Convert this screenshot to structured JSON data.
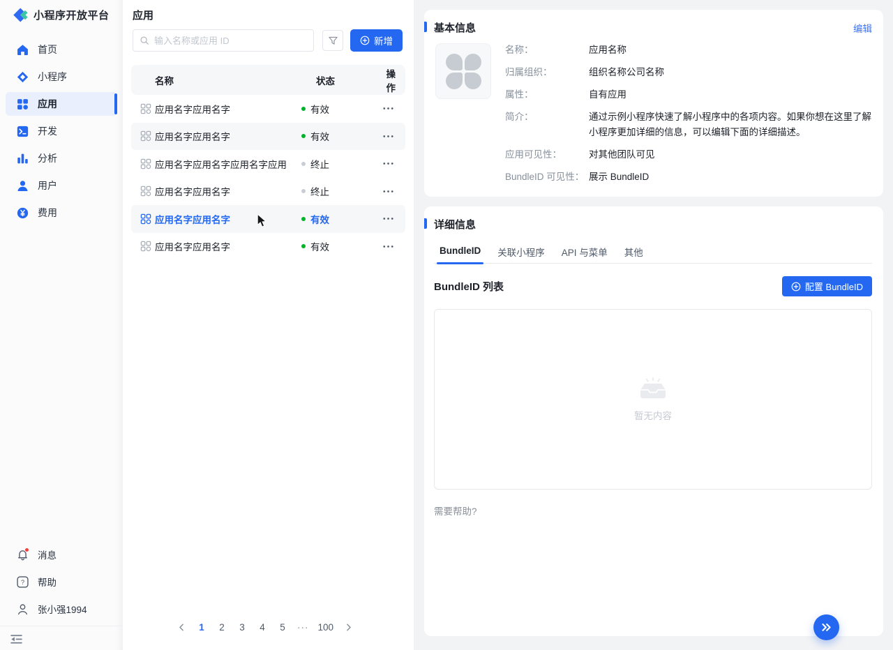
{
  "colors": {
    "primary": "#2468F2",
    "status_active": "#00B42A",
    "status_terminated": "#C9CDD4",
    "badge_red": "#F53F3F"
  },
  "brand": {
    "title": "小程序开放平台"
  },
  "sidebar": {
    "nav": [
      {
        "label": "首页",
        "icon": "home",
        "active": false
      },
      {
        "label": "小程序",
        "icon": "miniprogram",
        "active": false
      },
      {
        "label": "应用",
        "icon": "apps",
        "active": true
      },
      {
        "label": "开发",
        "icon": "terminal",
        "active": false
      },
      {
        "label": "分析",
        "icon": "analytics",
        "active": false
      },
      {
        "label": "用户",
        "icon": "user",
        "active": false
      },
      {
        "label": "费用",
        "icon": "billing",
        "active": false
      }
    ],
    "footer": [
      {
        "label": "消息",
        "icon": "bell",
        "badge": true
      },
      {
        "label": "帮助",
        "icon": "help",
        "badge": false
      },
      {
        "label": "张小强1994",
        "icon": "profile",
        "badge": false
      }
    ]
  },
  "app_list": {
    "title": "应用",
    "search_placeholder": "输入名称或应用 ID",
    "add_button": "新增",
    "columns": {
      "name": "名称",
      "status": "状态",
      "actions": "操作"
    },
    "rows": [
      {
        "name": "应用名字应用名字",
        "status": "有效",
        "state": "active-state",
        "bg": "white",
        "selected": false
      },
      {
        "name": "应用名字应用名字",
        "status": "有效",
        "state": "active-state",
        "bg": "gray",
        "selected": false
      },
      {
        "name": "应用名字应用名字应用名字应用",
        "status": "终止",
        "state": "terminated",
        "bg": "white",
        "selected": false
      },
      {
        "name": "应用名字应用名字",
        "status": "终止",
        "state": "terminated",
        "bg": "white",
        "selected": false
      },
      {
        "name": "应用名字应用名字",
        "status": "有效",
        "state": "active-state",
        "bg": "gray",
        "selected": true
      },
      {
        "name": "应用名字应用名字",
        "status": "有效",
        "state": "active-state",
        "bg": "white",
        "selected": false
      }
    ],
    "pagination": {
      "items": [
        {
          "type": "prev"
        },
        {
          "type": "page",
          "label": "1",
          "active": true
        },
        {
          "type": "page",
          "label": "2",
          "active": false
        },
        {
          "type": "page",
          "label": "3",
          "active": false
        },
        {
          "type": "page",
          "label": "4",
          "active": false
        },
        {
          "type": "page",
          "label": "5",
          "active": false
        },
        {
          "type": "ellipsis",
          "label": "···"
        },
        {
          "type": "page",
          "label": "100",
          "active": false
        },
        {
          "type": "next"
        }
      ]
    }
  },
  "basic_info": {
    "title": "基本信息",
    "edit_link": "编辑",
    "fields": [
      {
        "label": "名称：",
        "value": "应用名称"
      },
      {
        "label": "归属组织：",
        "value": "组织名称公司名称"
      },
      {
        "label": "属性：",
        "value": "自有应用"
      },
      {
        "label": "简介：",
        "value": "通过示例小程序快速了解小程序中的各项内容。如果你想在这里了解小程序更加详细的信息，可以编辑下面的详细描述。"
      },
      {
        "label": "应用可见性：",
        "value": "对其他团队可见"
      },
      {
        "label": "BundleID 可见性：",
        "value": "展示 BundleID"
      }
    ]
  },
  "detail_info": {
    "title": "详细信息",
    "tabs": [
      {
        "label": "BundleID",
        "active": true
      },
      {
        "label": "关联小程序",
        "active": false
      },
      {
        "label": "API 与菜单",
        "active": false
      },
      {
        "label": "其他",
        "active": false
      }
    ],
    "list_title": "BundleID 列表",
    "config_button": "配置 BundleID",
    "empty_text": "暂无内容",
    "help_text": "需要帮助?"
  }
}
